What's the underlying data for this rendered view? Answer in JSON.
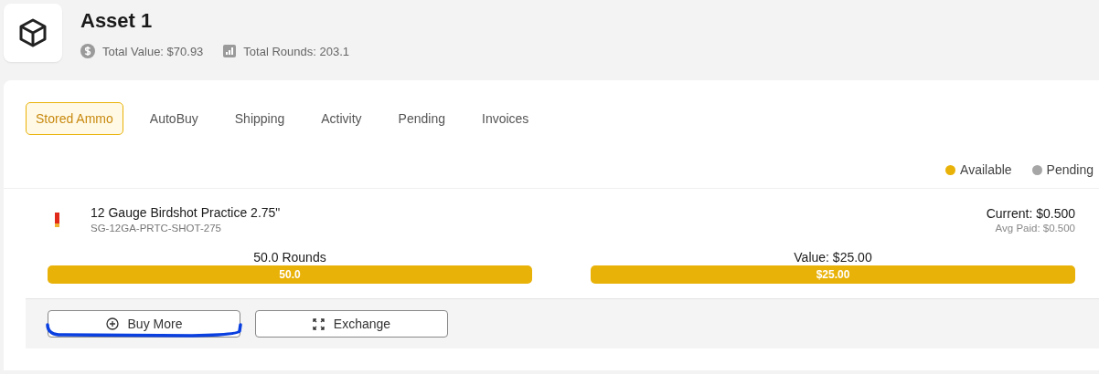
{
  "asset": {
    "title": "Asset 1",
    "stats": [
      {
        "kind": "value",
        "text": "Total Value: $70.93"
      },
      {
        "kind": "rounds",
        "text": "Total Rounds: 203.1"
      }
    ]
  },
  "tabs": [
    {
      "label": "Stored Ammo",
      "selected": true
    },
    {
      "label": "AutoBuy",
      "selected": false
    },
    {
      "label": "Shipping",
      "selected": false
    },
    {
      "label": "Activity",
      "selected": false
    },
    {
      "label": "Pending",
      "selected": false
    },
    {
      "label": "Invoices",
      "selected": false
    }
  ],
  "legend": [
    {
      "label": "Available",
      "color": "#e9b208"
    },
    {
      "label": "Pending",
      "color": "#a6a6a6"
    }
  ],
  "items": [
    {
      "name": "12 Gauge Birdshot Practice 2.75\"",
      "sku": "SG-12GA-PRTC-SHOT-275",
      "current": "Current: $0.500",
      "avg_paid": "Avg Paid: $0.500",
      "meters": [
        {
          "label": "50.0 Rounds",
          "reading": "50.0",
          "level": 1
        },
        {
          "label": "Value: $25.00",
          "reading": "$25.00",
          "level": 1
        }
      ],
      "actions": [
        {
          "kind": "buy",
          "label": "Buy More"
        },
        {
          "kind": "exchange",
          "label": "Exchange"
        }
      ]
    }
  ]
}
